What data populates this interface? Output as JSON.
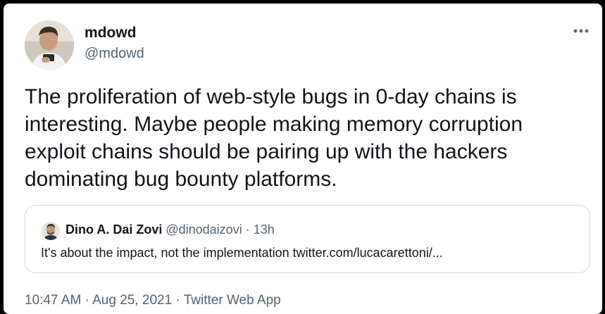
{
  "tweet": {
    "author": {
      "name": "mdowd",
      "handle": "@mdowd",
      "avatar_icon": "user-avatar-photo"
    },
    "more_icon": "more-horizontal-icon",
    "text": "The proliferation of web-style bugs in 0-day chains is interesting. Maybe people making memory corruption exploit chains should be pairing up with the hackers dominating bug bounty platforms.",
    "quote": {
      "name": "Dino A. Dai Zovi",
      "handle": "@dinodaizovi",
      "separator": "·",
      "time": "13h",
      "text": "It's about the impact, not the implementation twitter.com/lucacarettoni/...",
      "avatar_icon": "quoted-user-avatar"
    },
    "meta": {
      "time": "10:47 AM",
      "separator1": "·",
      "date": "Aug 25, 2021",
      "separator2": "·",
      "source": "Twitter Web App"
    }
  },
  "colors": {
    "background": "#000000",
    "card": "#ffffff",
    "text_primary": "#0f1419",
    "text_secondary": "#536471",
    "border": "#cfd9de"
  }
}
